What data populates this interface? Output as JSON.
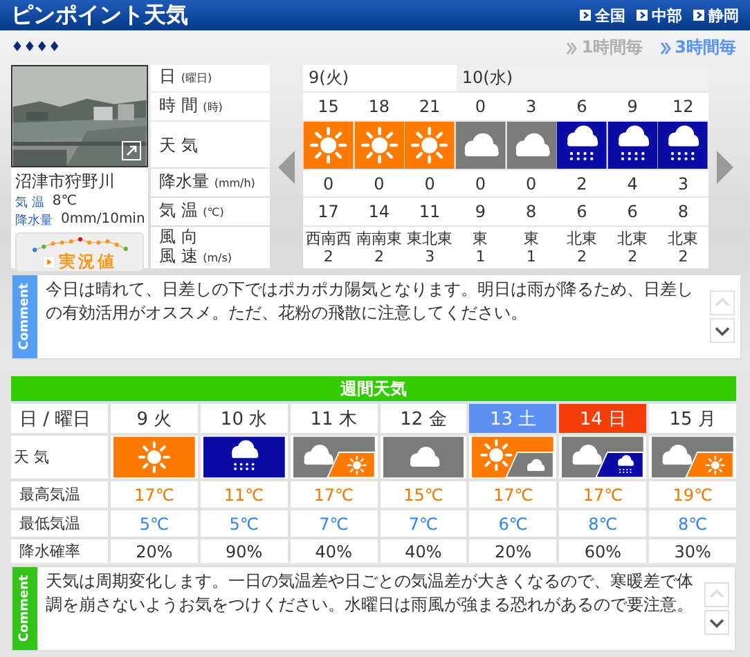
{
  "header": {
    "title": "ピンポイント天気",
    "breadcrumb": [
      "全国",
      "中部",
      "静岡"
    ]
  },
  "location_mark": "♦♦♦♦",
  "interval_tabs": [
    {
      "label": "1時間毎",
      "selected": false
    },
    {
      "label": "3時間毎",
      "selected": true
    }
  ],
  "live": {
    "place": "沼津市狩野川",
    "temp_label": "気 温",
    "temp": "8℃",
    "rain_label": "降水量",
    "rain": "0mm/10min",
    "button": "実況値"
  },
  "hourly": {
    "row_labels": [
      {
        "text": "日",
        "unit": "(曜日)"
      },
      {
        "text": "時 間",
        "unit": "(時)"
      },
      {
        "text": "天 気"
      },
      {
        "text": "降水量",
        "unit": "(mm/h)"
      },
      {
        "text": "気 温",
        "unit": "(℃)"
      },
      {
        "text": "風 向",
        "text2": "風 速",
        "unit": "(m/s)"
      }
    ],
    "days": [
      {
        "label": "9(火)",
        "slots": [
          {
            "hour": "15",
            "weather": [
              {
                "kind": "sunny"
              }
            ],
            "rain": "0",
            "temp": "17",
            "wind_dir": "西南西",
            "wind_speed": "2"
          },
          {
            "hour": "18",
            "weather": [
              {
                "kind": "sunny"
              }
            ],
            "rain": "0",
            "temp": "14",
            "wind_dir": "南南東",
            "wind_speed": "2"
          },
          {
            "hour": "21",
            "weather": [
              {
                "kind": "sunny"
              }
            ],
            "rain": "0",
            "temp": "11",
            "wind_dir": "東北東",
            "wind_speed": "3"
          }
        ]
      },
      {
        "label": "10(水)",
        "slots": [
          {
            "hour": "0",
            "weather": [
              {
                "kind": "cloudy"
              }
            ],
            "rain": "0",
            "temp": "9",
            "wind_dir": "東",
            "wind_speed": "1"
          },
          {
            "hour": "3",
            "weather": [
              {
                "kind": "cloudy"
              }
            ],
            "rain": "0",
            "temp": "8",
            "wind_dir": "東",
            "wind_speed": "1"
          },
          {
            "hour": "6",
            "weather": [
              {
                "kind": "rain"
              }
            ],
            "rain": "2",
            "temp": "6",
            "wind_dir": "北東",
            "wind_speed": "2"
          },
          {
            "hour": "9",
            "weather": [
              {
                "kind": "rain"
              }
            ],
            "rain": "4",
            "temp": "6",
            "wind_dir": "北東",
            "wind_speed": "2"
          },
          {
            "hour": "12",
            "weather": [
              {
                "kind": "rain"
              }
            ],
            "rain": "3",
            "temp": "8",
            "wind_dir": "北東",
            "wind_speed": "2"
          }
        ]
      }
    ]
  },
  "comment": {
    "label": "Comment",
    "text": "今日は晴れて、日差しの下ではポカポカ陽気となります。明日は雨が降るため、日差しの有効活用がオススメ。ただ、花粉の飛散に注意してください。",
    "can_scroll_up": false,
    "can_scroll_down": true
  },
  "weekly": {
    "title": "週間天気",
    "row_labels": [
      "日 / 曜日",
      "天 気",
      "最高気温",
      "最低気温",
      "降水確率"
    ],
    "days": [
      {
        "label": "9 火",
        "kind": "weekday",
        "weather": [
          {
            "kind": "sunny"
          }
        ],
        "high": "17℃",
        "low": "5℃",
        "pop": "20%"
      },
      {
        "label": "10 水",
        "kind": "weekday",
        "weather": [
          {
            "kind": "rain"
          }
        ],
        "high": "11℃",
        "low": "5℃",
        "pop": "90%"
      },
      {
        "label": "11 木",
        "kind": "weekday",
        "weather": [
          {
            "kind": "cloudy"
          },
          {
            "kind": "sunny"
          }
        ],
        "high": "17℃",
        "low": "7℃",
        "pop": "40%"
      },
      {
        "label": "12 金",
        "kind": "weekday",
        "weather": [
          {
            "kind": "cloudy"
          }
        ],
        "high": "15℃",
        "low": "7℃",
        "pop": "40%"
      },
      {
        "label": "13 土",
        "kind": "saturday",
        "weather": [
          {
            "kind": "sunny"
          },
          {
            "kind": "cloudy"
          }
        ],
        "high": "17℃",
        "low": "6℃",
        "pop": "20%"
      },
      {
        "label": "14 日",
        "kind": "sunday",
        "weather": [
          {
            "kind": "cloudy"
          },
          {
            "kind": "rain"
          }
        ],
        "high": "17℃",
        "low": "8℃",
        "pop": "60%"
      },
      {
        "label": "15 月",
        "kind": "weekday",
        "weather": [
          {
            "kind": "cloudy"
          },
          {
            "kind": "sunny"
          }
        ],
        "high": "19℃",
        "low": "8℃",
        "pop": "30%"
      }
    ]
  },
  "weekly_comment": {
    "label": "Comment",
    "text": "天気は周期変化します。一日の気温差や日ごとの気温差が大きくなるので、寒暖差で体調を崩さないようお気をつけください。水曜日は雨風が強まる恐れがあるので要注意。",
    "can_scroll_up": false,
    "can_scroll_down": true
  }
}
